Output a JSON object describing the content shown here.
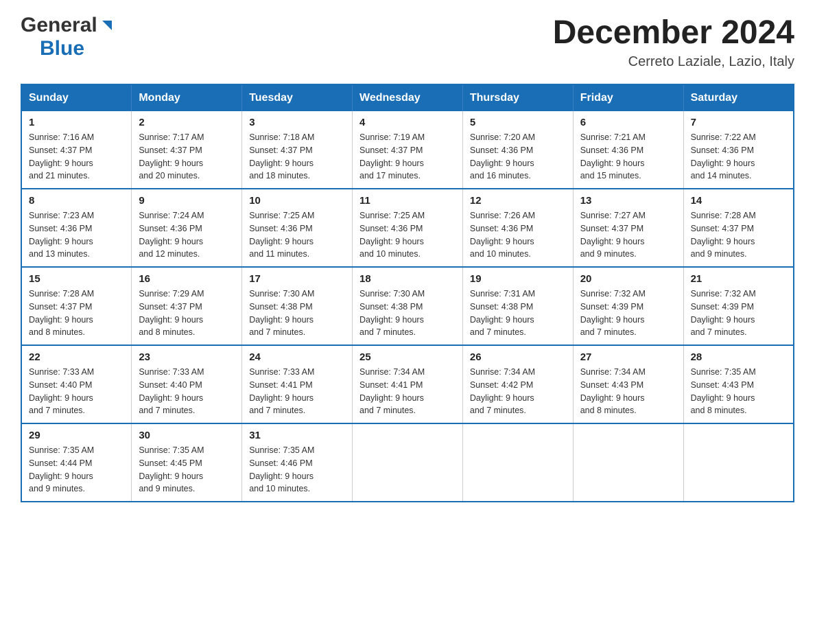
{
  "header": {
    "month_year": "December 2024",
    "location": "Cerreto Laziale, Lazio, Italy",
    "logo_general": "General",
    "logo_blue": "Blue"
  },
  "days_of_week": [
    "Sunday",
    "Monday",
    "Tuesday",
    "Wednesday",
    "Thursday",
    "Friday",
    "Saturday"
  ],
  "weeks": [
    [
      {
        "day": "1",
        "sunrise": "7:16 AM",
        "sunset": "4:37 PM",
        "daylight": "9 hours and 21 minutes."
      },
      {
        "day": "2",
        "sunrise": "7:17 AM",
        "sunset": "4:37 PM",
        "daylight": "9 hours and 20 minutes."
      },
      {
        "day": "3",
        "sunrise": "7:18 AM",
        "sunset": "4:37 PM",
        "daylight": "9 hours and 18 minutes."
      },
      {
        "day": "4",
        "sunrise": "7:19 AM",
        "sunset": "4:37 PM",
        "daylight": "9 hours and 17 minutes."
      },
      {
        "day": "5",
        "sunrise": "7:20 AM",
        "sunset": "4:36 PM",
        "daylight": "9 hours and 16 minutes."
      },
      {
        "day": "6",
        "sunrise": "7:21 AM",
        "sunset": "4:36 PM",
        "daylight": "9 hours and 15 minutes."
      },
      {
        "day": "7",
        "sunrise": "7:22 AM",
        "sunset": "4:36 PM",
        "daylight": "9 hours and 14 minutes."
      }
    ],
    [
      {
        "day": "8",
        "sunrise": "7:23 AM",
        "sunset": "4:36 PM",
        "daylight": "9 hours and 13 minutes."
      },
      {
        "day": "9",
        "sunrise": "7:24 AM",
        "sunset": "4:36 PM",
        "daylight": "9 hours and 12 minutes."
      },
      {
        "day": "10",
        "sunrise": "7:25 AM",
        "sunset": "4:36 PM",
        "daylight": "9 hours and 11 minutes."
      },
      {
        "day": "11",
        "sunrise": "7:25 AM",
        "sunset": "4:36 PM",
        "daylight": "9 hours and 10 minutes."
      },
      {
        "day": "12",
        "sunrise": "7:26 AM",
        "sunset": "4:36 PM",
        "daylight": "9 hours and 10 minutes."
      },
      {
        "day": "13",
        "sunrise": "7:27 AM",
        "sunset": "4:37 PM",
        "daylight": "9 hours and 9 minutes."
      },
      {
        "day": "14",
        "sunrise": "7:28 AM",
        "sunset": "4:37 PM",
        "daylight": "9 hours and 9 minutes."
      }
    ],
    [
      {
        "day": "15",
        "sunrise": "7:28 AM",
        "sunset": "4:37 PM",
        "daylight": "9 hours and 8 minutes."
      },
      {
        "day": "16",
        "sunrise": "7:29 AM",
        "sunset": "4:37 PM",
        "daylight": "9 hours and 8 minutes."
      },
      {
        "day": "17",
        "sunrise": "7:30 AM",
        "sunset": "4:38 PM",
        "daylight": "9 hours and 7 minutes."
      },
      {
        "day": "18",
        "sunrise": "7:30 AM",
        "sunset": "4:38 PM",
        "daylight": "9 hours and 7 minutes."
      },
      {
        "day": "19",
        "sunrise": "7:31 AM",
        "sunset": "4:38 PM",
        "daylight": "9 hours and 7 minutes."
      },
      {
        "day": "20",
        "sunrise": "7:32 AM",
        "sunset": "4:39 PM",
        "daylight": "9 hours and 7 minutes."
      },
      {
        "day": "21",
        "sunrise": "7:32 AM",
        "sunset": "4:39 PM",
        "daylight": "9 hours and 7 minutes."
      }
    ],
    [
      {
        "day": "22",
        "sunrise": "7:33 AM",
        "sunset": "4:40 PM",
        "daylight": "9 hours and 7 minutes."
      },
      {
        "day": "23",
        "sunrise": "7:33 AM",
        "sunset": "4:40 PM",
        "daylight": "9 hours and 7 minutes."
      },
      {
        "day": "24",
        "sunrise": "7:33 AM",
        "sunset": "4:41 PM",
        "daylight": "9 hours and 7 minutes."
      },
      {
        "day": "25",
        "sunrise": "7:34 AM",
        "sunset": "4:41 PM",
        "daylight": "9 hours and 7 minutes."
      },
      {
        "day": "26",
        "sunrise": "7:34 AM",
        "sunset": "4:42 PM",
        "daylight": "9 hours and 7 minutes."
      },
      {
        "day": "27",
        "sunrise": "7:34 AM",
        "sunset": "4:43 PM",
        "daylight": "9 hours and 8 minutes."
      },
      {
        "day": "28",
        "sunrise": "7:35 AM",
        "sunset": "4:43 PM",
        "daylight": "9 hours and 8 minutes."
      }
    ],
    [
      {
        "day": "29",
        "sunrise": "7:35 AM",
        "sunset": "4:44 PM",
        "daylight": "9 hours and 9 minutes."
      },
      {
        "day": "30",
        "sunrise": "7:35 AM",
        "sunset": "4:45 PM",
        "daylight": "9 hours and 9 minutes."
      },
      {
        "day": "31",
        "sunrise": "7:35 AM",
        "sunset": "4:46 PM",
        "daylight": "9 hours and 10 minutes."
      },
      null,
      null,
      null,
      null
    ]
  ],
  "labels": {
    "sunrise": "Sunrise:",
    "sunset": "Sunset:",
    "daylight": "Daylight:"
  }
}
